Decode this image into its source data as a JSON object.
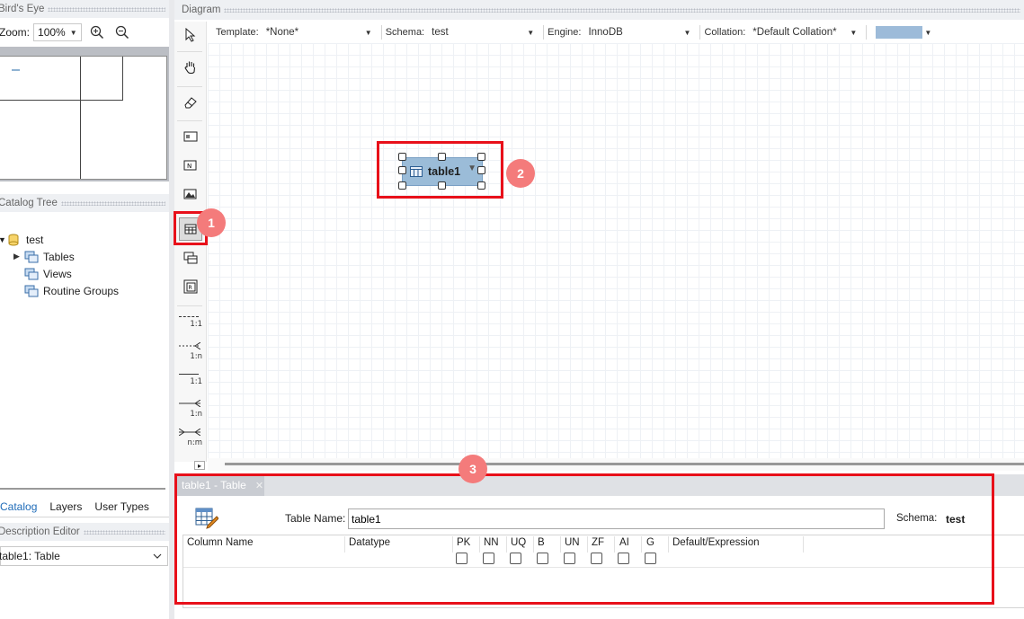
{
  "birds_eye": {
    "title": "Bird's Eye",
    "zoom_label": "Zoom:",
    "zoom_value": "100%"
  },
  "diagram": {
    "title": "Diagram"
  },
  "catalog_tree": {
    "title": "Catalog Tree",
    "schema": "test",
    "items": [
      {
        "label": "Tables"
      },
      {
        "label": "Views"
      },
      {
        "label": "Routine Groups"
      }
    ]
  },
  "left_tabs": [
    "Catalog",
    "Layers",
    "User Types"
  ],
  "description_editor": {
    "title": "Description Editor",
    "selected": "table1: Table"
  },
  "options_bar": {
    "template_label": "Template:",
    "template_value": "*None*",
    "schema_label": "Schema:",
    "schema_value": "test",
    "engine_label": "Engine:",
    "engine_value": "InnoDB",
    "collation_label": "Collation:",
    "collation_value": "*Default Collation*",
    "color_value": "#9dbbd9"
  },
  "relationship_tools": [
    "1:1",
    "1:n",
    "1:1",
    "1:n",
    "n:m"
  ],
  "canvas": {
    "table_name": "table1",
    "table_color": "#9bbcd8"
  },
  "callouts": [
    "1",
    "2",
    "3"
  ],
  "editor": {
    "tab_label": "table1 - Table",
    "table_name_label": "Table Name:",
    "table_name_value": "table1",
    "schema_label": "Schema:",
    "schema_value": "test",
    "columns": {
      "headers": [
        "Column Name",
        "Datatype",
        "PK",
        "NN",
        "UQ",
        "B",
        "UN",
        "ZF",
        "AI",
        "G",
        "Default/Expression"
      ]
    }
  },
  "colors": {
    "accent_red": "#e8101a",
    "badge": "#f47b7b",
    "link_blue": "#1e6bb8"
  }
}
